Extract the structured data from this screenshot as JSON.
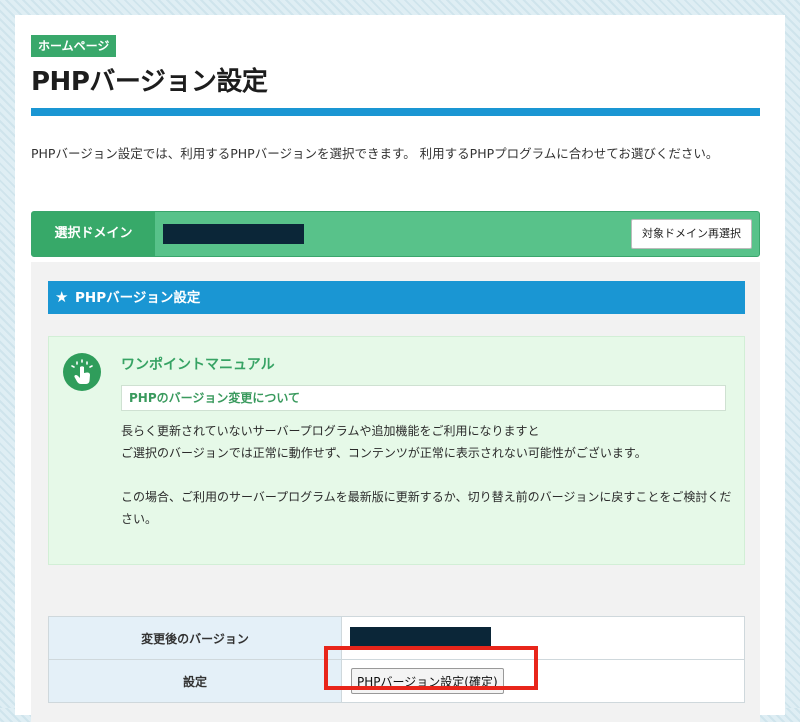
{
  "header": {
    "badge": "ホームページ",
    "title": "PHPバージョン設定"
  },
  "intro": "PHPバージョン設定では、利用するPHPバージョンを選択できます。 利用するPHPプログラムに合わせてお選びください。",
  "domain": {
    "label": "選択ドメイン",
    "value": "",
    "reselect_label": "対象ドメイン再選択"
  },
  "section": {
    "star": "★",
    "title": "PHPバージョン設定"
  },
  "manual": {
    "icon": "pointing-hand-icon",
    "title": "ワンポイントマニュアル",
    "subtitle": "PHPのバージョン変更について",
    "line1": "長らく更新されていないサーバープログラムや追加機能をご利用になりますと",
    "line2": "ご選択のバージョンでは正常に動作せず、コンテンツが正常に表示されない可能性がございます。",
    "line3": "この場合、ご利用のサーバープログラムを最新版に更新するか、切り替え前のバージョンに戻すことをご検討ください。"
  },
  "table": {
    "row1_label": "変更後のバージョン",
    "row1_value": "",
    "row2_label": "設定",
    "confirm_label": "PHPバージョン設定(確定)"
  },
  "colors": {
    "accent_blue": "#1a96d3",
    "green": "#39a86b",
    "highlight_red": "#e8251a"
  }
}
